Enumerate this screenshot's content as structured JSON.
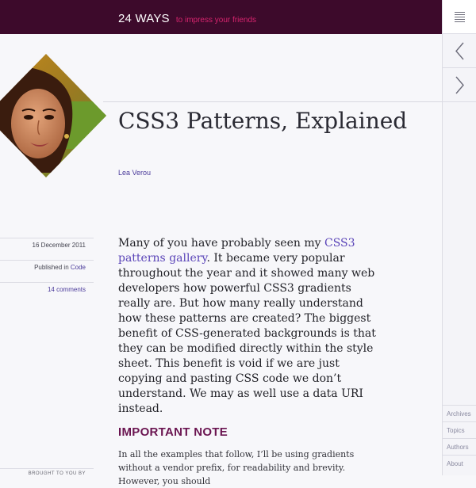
{
  "header": {
    "brand": "24 WAYS",
    "tagline": "to impress your friends"
  },
  "rail": {
    "menu_icon": "hamburger-icon",
    "prev_icon": "chevron-left-icon",
    "next_icon": "chevron-right-icon",
    "links": [
      "Archives",
      "Topics",
      "Authors",
      "About"
    ]
  },
  "article": {
    "title": "CSS3 Patterns, Explained",
    "author": "Lea Verou",
    "meta": {
      "date": "16 December 2011",
      "published_prefix": "Published in ",
      "category": "Code",
      "comments": "14 comments",
      "brought_by": "BROUGHT TO YOU BY"
    },
    "lead_before": "Many of you have probably seen my ",
    "lead_link": "CSS3 patterns gallery",
    "lead_after": ". It became very popular throughout the year and it showed many web developers how powerful CSS3 gradients really are. But how many really understand how these patterns are created? The biggest benefit of CSS-generated backgrounds is that they can be modified directly within the style sheet. This benefit is void if we are just copying and pasting CSS code we don’t understand. We may as well use a data URI instead.",
    "subhead": "IMPORTANT NOTE",
    "body2": "In all the examples that follow, I’ll be using gradients without a vendor prefix, for readability and brevity. However, you should"
  },
  "colors": {
    "header_bg": "#3d0a2b",
    "accent_pink": "#d6246e",
    "link": "#4a3a9a",
    "subhead": "#6a1450"
  }
}
